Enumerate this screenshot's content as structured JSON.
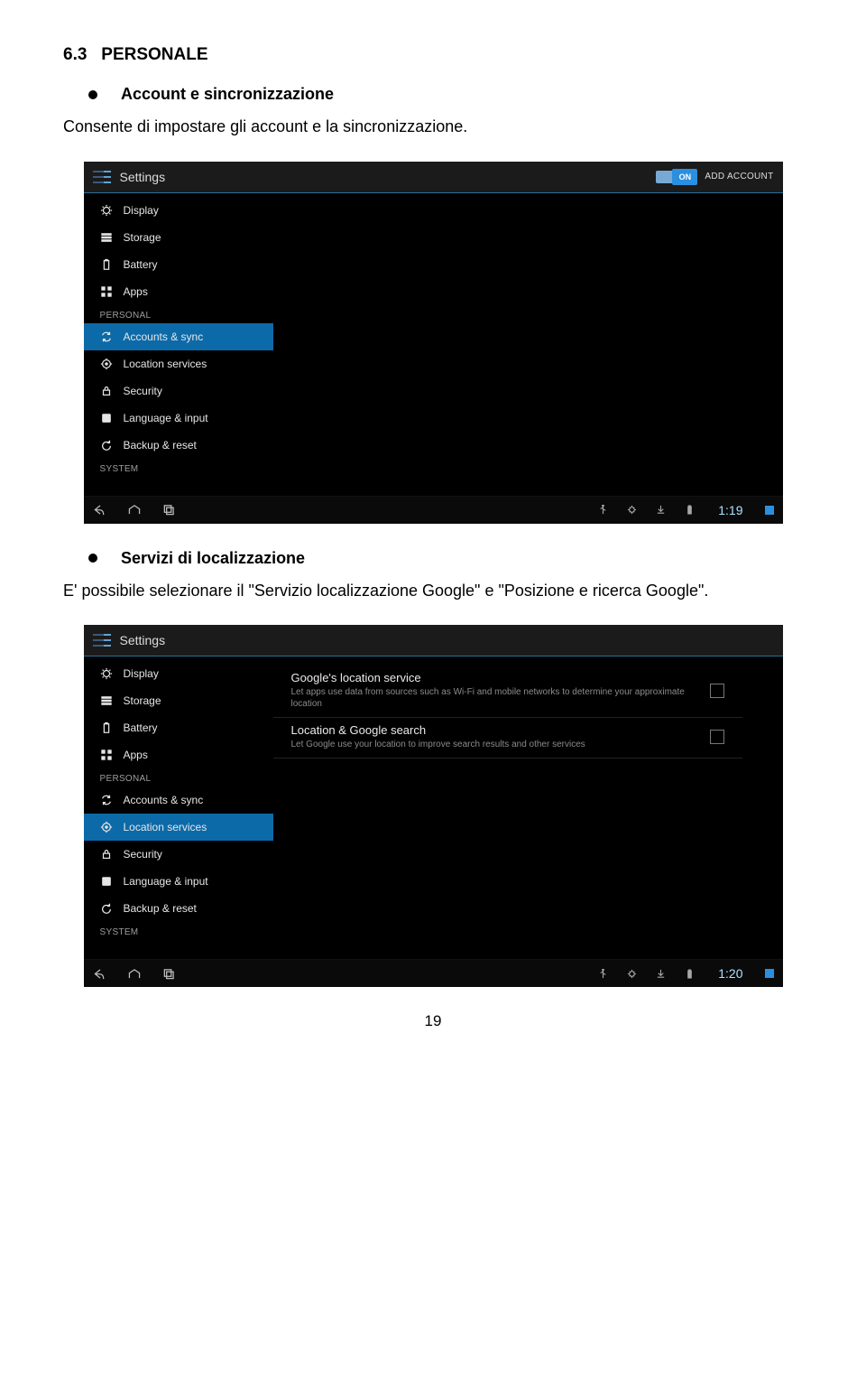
{
  "doc": {
    "section_number": "6.3",
    "section_title": "PERSONALE",
    "bullet1_title": "Account e sincronizzazione",
    "para1": "Consente di impostare gli account e la sincronizzazione.",
    "bullet2_title": "Servizi di localizzazione",
    "para2": "E' possibile selezionare il \"Servizio localizzazione Google\" e \"Posizione e ricerca Google\".",
    "page_number": "19"
  },
  "shot1": {
    "header": "Settings",
    "toggle_label": "ON",
    "add_account": "ADD ACCOUNT",
    "sidebar": {
      "items": [
        {
          "label": "Display",
          "icon": "display"
        },
        {
          "label": "Storage",
          "icon": "storage"
        },
        {
          "label": "Battery",
          "icon": "battery"
        },
        {
          "label": "Apps",
          "icon": "apps"
        }
      ],
      "personal_header": "PERSONAL",
      "personal_items": [
        {
          "label": "Accounts & sync",
          "icon": "sync",
          "selected": true
        },
        {
          "label": "Location services",
          "icon": "location"
        },
        {
          "label": "Security",
          "icon": "lock"
        },
        {
          "label": "Language & input",
          "icon": "lang"
        },
        {
          "label": "Backup & reset",
          "icon": "backup"
        }
      ],
      "system_header": "SYSTEM"
    },
    "clock": "1:19"
  },
  "shot2": {
    "header": "Settings",
    "sidebar": {
      "items": [
        {
          "label": "Display",
          "icon": "display"
        },
        {
          "label": "Storage",
          "icon": "storage"
        },
        {
          "label": "Battery",
          "icon": "battery"
        },
        {
          "label": "Apps",
          "icon": "apps"
        }
      ],
      "personal_header": "PERSONAL",
      "personal_items": [
        {
          "label": "Accounts & sync",
          "icon": "sync"
        },
        {
          "label": "Location services",
          "icon": "location",
          "selected": true
        },
        {
          "label": "Security",
          "icon": "lock"
        },
        {
          "label": "Language & input",
          "icon": "lang"
        },
        {
          "label": "Backup & reset",
          "icon": "backup"
        }
      ],
      "system_header": "SYSTEM"
    },
    "content": [
      {
        "title": "Google's location service",
        "subtitle": "Let apps use data from sources such as Wi-Fi and mobile networks to determine your approximate location"
      },
      {
        "title": "Location & Google search",
        "subtitle": "Let Google use your location to improve search results and other services"
      }
    ],
    "clock": "1:20"
  }
}
